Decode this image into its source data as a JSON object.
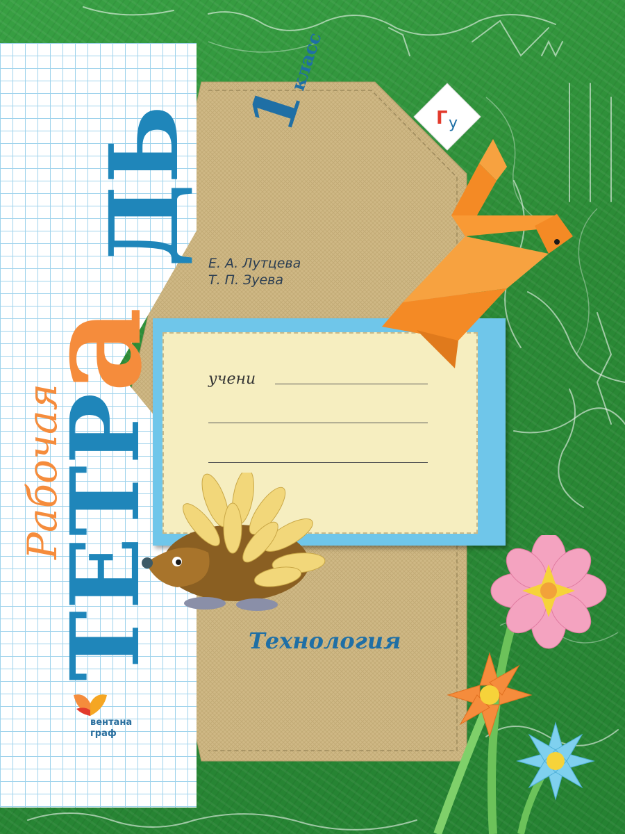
{
  "cover": {
    "word_rabochaya": "Рабочая",
    "word_tetr": "ТЕТР",
    "word_a": "а",
    "word_d": "ДЬ",
    "grade_number": "1",
    "grade_word": "класс",
    "authors": [
      "Е. А. Лутцева",
      "Т. П. Зуева"
    ],
    "student_label": "учени",
    "subject": "Технология",
    "publisher": [
      "вентана",
      "граф"
    ]
  },
  "icons": {
    "badge": "ry-logo-icon",
    "publisher_logo": "butterfly-logo-icon",
    "bird": "origami-bird-icon",
    "hedgehog": "hedgehog-applique-icon",
    "flowers": "paper-flower-icon"
  },
  "colors": {
    "green_background": "#2f8f3a",
    "kraft": "#cfb885",
    "blue_title": "#1f86ba",
    "orange": "#f58c3c",
    "plate_blue": "#6fc6ea",
    "plate_cream": "#f6eec0"
  }
}
